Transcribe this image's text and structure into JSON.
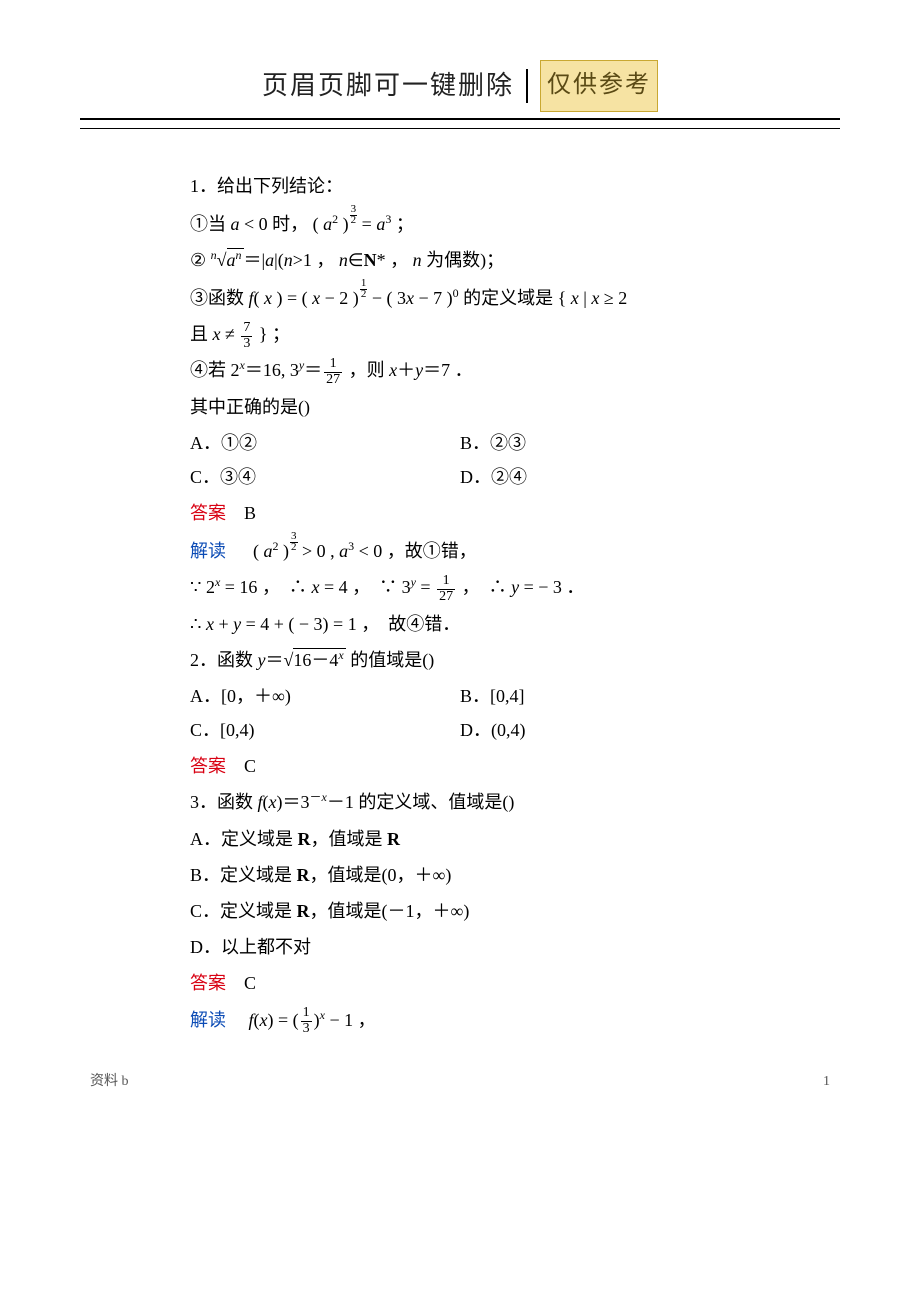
{
  "header": {
    "text": "页眉页脚可一键删除",
    "badge": "仅供参考"
  },
  "q1": {
    "stem": "1．给出下列结论：",
    "s1a": "①当 ",
    "s1b": " 时，",
    "s1c": "；",
    "s2a": "②",
    "s2b": "，",
    "s2c": "，",
    "s2d": " 为偶数)；",
    "s3a": "③函数",
    "s3b": " 的定义域是",
    "s3c": "且 ",
    "s3d": "；",
    "s4a": "④若 ",
    "s4b": "，则 ",
    "s4c": "．",
    "prompt": "其中正确的是()",
    "optA": "A．①②",
    "optB": "B．②③",
    "optC": "C．③④",
    "optD": "D．②④",
    "ansLabel": "答案",
    "ansVal": "　B",
    "expLabel": "解读",
    "exp1a": "　",
    "exp1b": "，故①错，",
    "exp2a": "∵",
    "exp2b": "，　∴",
    "exp2c": "，　∵",
    "exp2d": "，　∴",
    "exp2e": "．",
    "exp3a": "∴",
    "exp3b": "，　故④错．"
  },
  "q2": {
    "stem_a": "2．函数 ",
    "stem_b": "的值域是()",
    "optA": "A．[0，＋∞)",
    "optB": "B．[0,4]",
    "optC": "C．[0,4)",
    "optD": "D．(0,4)",
    "ansLabel": "答案",
    "ansVal": "　C"
  },
  "q3": {
    "stem_a": "3．函数 ",
    "stem_b": " 的定义域、值域是()",
    "optA_a": "A．定义域是 ",
    "optA_b": "，值域是 ",
    "optB_a": "B．定义域是 ",
    "optB_b": "，值域是(0，＋∞)",
    "optC_a": "C．定义域是 ",
    "optC_b": "，值域是(－1，＋∞)",
    "optD": "D．以上都不对",
    "ansLabel": "答案",
    "ansVal": "　C",
    "expLabel": "解读",
    "expBody": "，"
  },
  "footer": {
    "left": "资料 b",
    "right": "1"
  }
}
